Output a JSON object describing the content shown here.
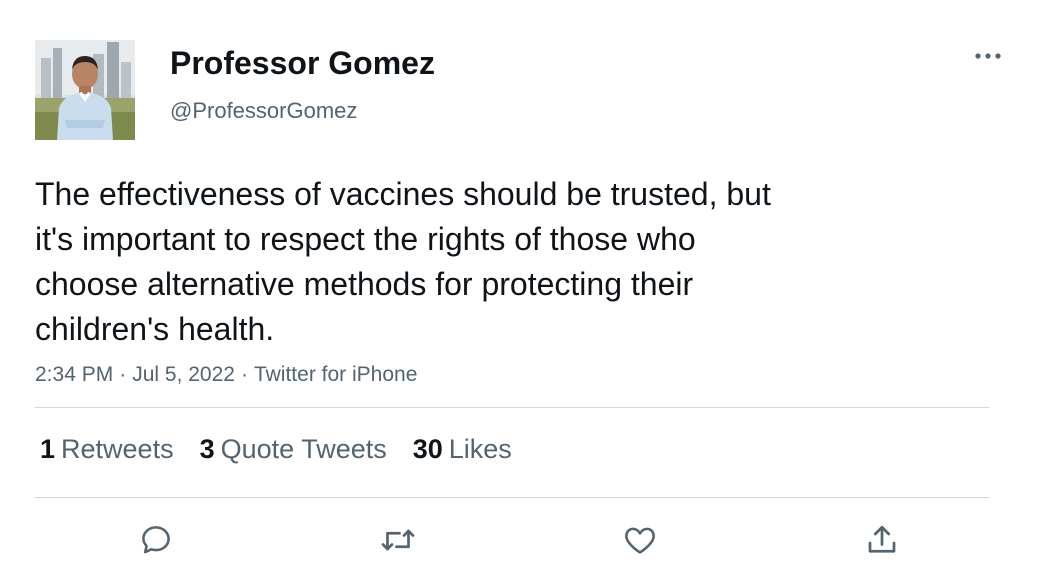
{
  "author": {
    "display_name": "Professor Gomez",
    "handle": "@ProfessorGomez",
    "avatar": "profile-photo-man-city-skyline"
  },
  "more_icon": "more-horizontal-icon",
  "tweet": {
    "lines": [
      "The effectiveness of vaccines should be trusted, but",
      "it's important to respect the rights of those who",
      "choose alternative methods for protecting their",
      "children's health."
    ],
    "time": "2:34 PM",
    "separator": "·",
    "date": "Jul 5, 2022",
    "source": "Twitter for iPhone"
  },
  "stats": {
    "retweets": {
      "count": "1",
      "label": "Retweets"
    },
    "quote_tweets": {
      "count": "3",
      "label": "Quote Tweets"
    },
    "likes": {
      "count": "30",
      "label": "Likes"
    }
  },
  "actions": [
    {
      "name": "reply",
      "icon": "speech-bubble-icon"
    },
    {
      "name": "retweet",
      "icon": "retweet-arrows-icon"
    },
    {
      "name": "like",
      "icon": "heart-icon"
    },
    {
      "name": "share",
      "icon": "share-upload-icon"
    }
  ],
  "colors": {
    "text_primary": "#0f1419",
    "text_secondary": "#536471",
    "divider": "#cfd9de"
  }
}
